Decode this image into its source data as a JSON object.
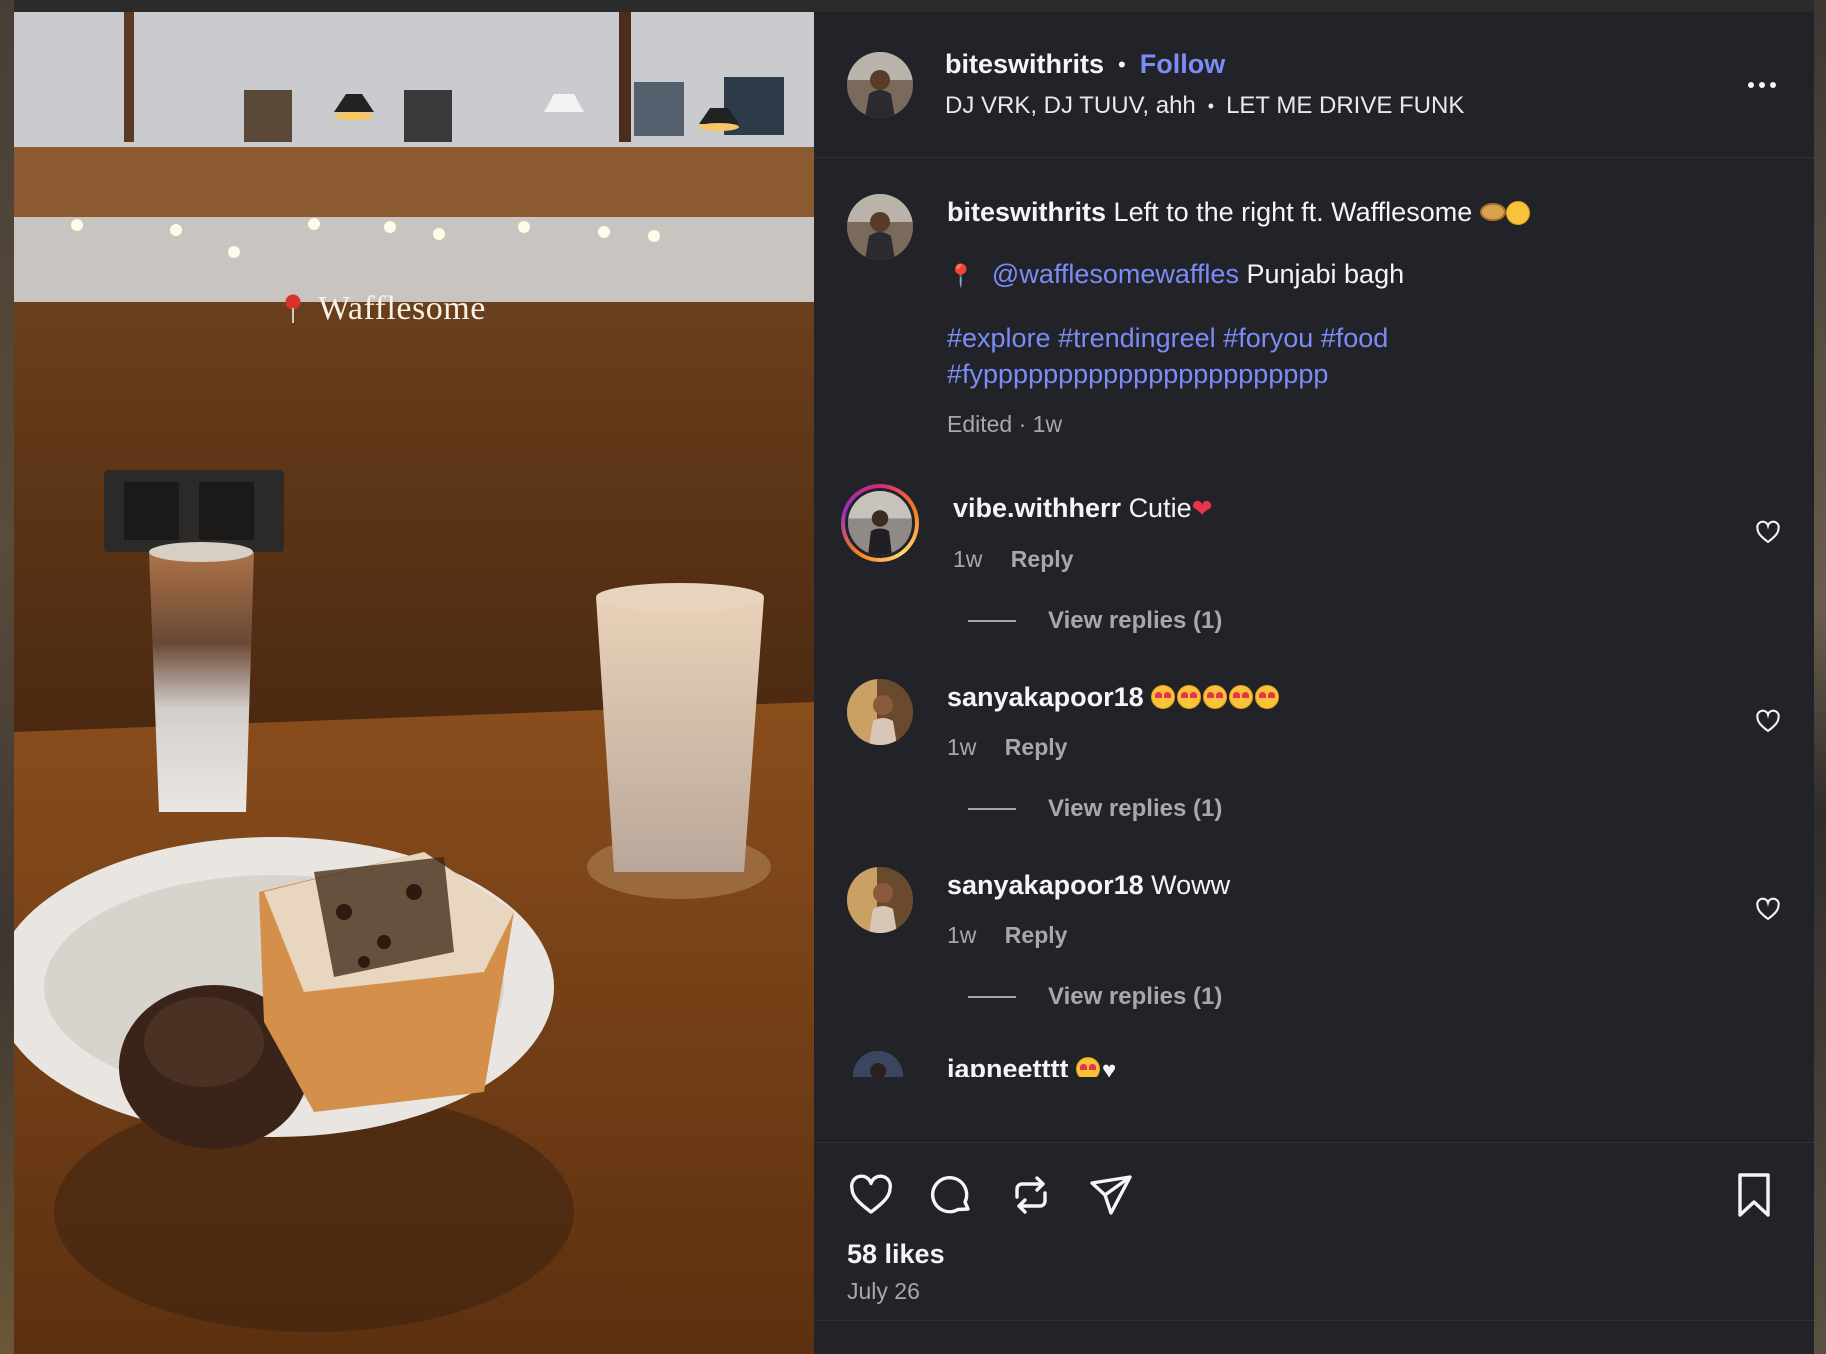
{
  "post": {
    "author": "biteswithrits",
    "follow_label": "Follow",
    "separator": "•",
    "audio_artists": "DJ VRK, DJ TUUV, ahh",
    "audio_track": "LET ME DRIVE FUNK",
    "more_icon": "more-horizontal-icon",
    "location_overlay": "Wafflesome"
  },
  "caption": {
    "username": "biteswithrits",
    "text": "Left to the right ft. Wafflesome",
    "mention": "@wafflesomewaffles",
    "location": "Punjabi bagh",
    "hashtags_line1": "#explore #trendingreel #foryou #food",
    "hashtags_line2": "#fyppppppppppppppppppppppp",
    "meta": "Edited · 1w"
  },
  "comments": [
    {
      "username": "vibe.withherr",
      "text": "Cutie",
      "time": "1w",
      "reply_label": "Reply",
      "view_replies": "View replies (1)"
    },
    {
      "username": "sanyakapoor18",
      "text": "",
      "time": "1w",
      "reply_label": "Reply",
      "view_replies": "View replies (1)"
    },
    {
      "username": "sanyakapoor18",
      "text": "Woww",
      "time": "1w",
      "reply_label": "Reply",
      "view_replies": "View replies (1)"
    },
    {
      "username": "japneetttt",
      "text": ""
    }
  ],
  "actions": {
    "likes": "58 likes",
    "date": "July 26"
  },
  "colors": {
    "panel_bg": "#212328",
    "link": "#7b8cf7",
    "muted": "#a8a8a8"
  }
}
